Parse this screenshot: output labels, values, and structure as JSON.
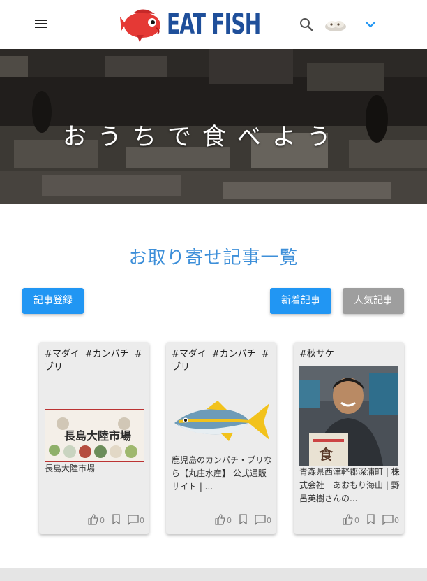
{
  "header": {
    "logo_text": "EAT FISH",
    "menu_icon": "hamburger-menu-icon",
    "search_icon": "search-icon",
    "account_icon": "avatar-icon",
    "dropdown_icon": "chevron-down-icon"
  },
  "hero": {
    "title": "おうちで食べよう"
  },
  "section": {
    "title": "お取り寄せ記事一覧"
  },
  "buttons": {
    "register": "記事登録",
    "newest": "新着記事",
    "popular": "人気記事"
  },
  "cards": [
    {
      "tags": [
        "#マダイ",
        "#カンパチ",
        "#ブリ"
      ],
      "title": "長島大陸市場",
      "likes": "0",
      "comments": "0",
      "thumb_text": "長島大陸市場"
    },
    {
      "tags": [
        "#マダイ",
        "#カンパチ",
        "#ブリ"
      ],
      "title": "鹿児島のカンパチ・ブリなら【丸庄水産】 公式通販サイト | ...",
      "likes": "0",
      "comments": "0"
    },
    {
      "tags": [
        "#秋サケ"
      ],
      "title": "青森県西津軽郡深浦町 | 株式会社　あおもり海山 | 野呂英樹さんの...",
      "likes": "0",
      "comments": "0",
      "thumb_text": "食"
    }
  ],
  "colors": {
    "accent": "#2196f3",
    "title_blue": "#3d8fd9",
    "logo_blue": "#1f4f9a",
    "button_grey": "#9e9e9e",
    "card_bg": "#ececec"
  }
}
